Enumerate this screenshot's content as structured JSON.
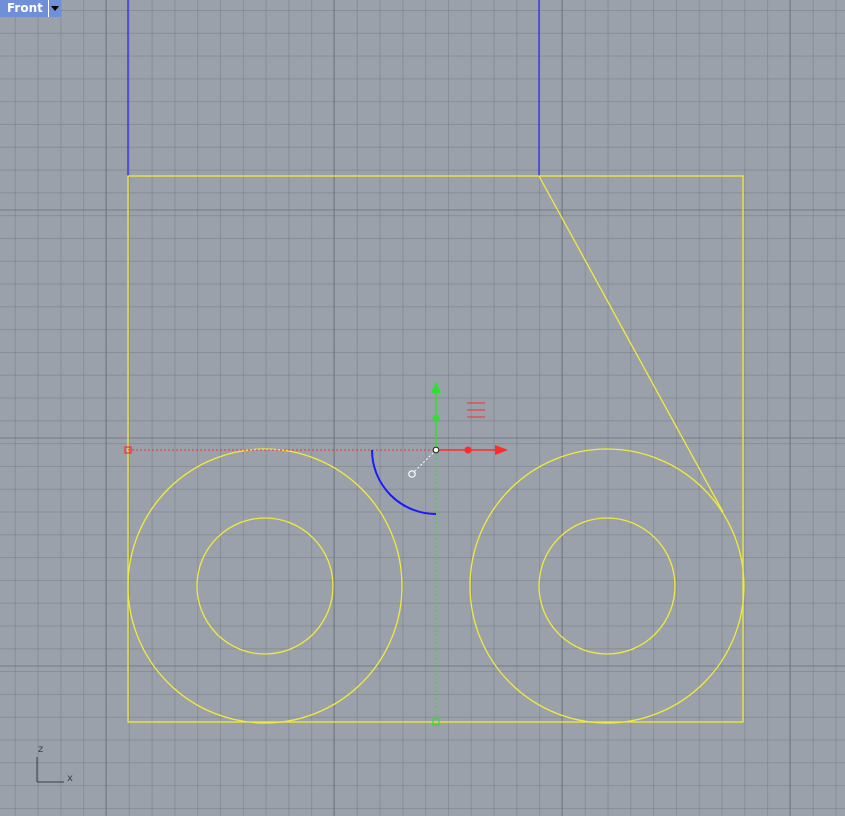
{
  "viewport": {
    "title": "Front",
    "view_menu_icon": "triangle-down-icon"
  },
  "axis_indicator": {
    "vertical_label": "z",
    "horizontal_label": "x"
  },
  "colors": {
    "background": "#9ba1aa",
    "grid": "#7e8690",
    "grid_major": "#6a727c",
    "curve_selected": "#f2ea3a",
    "curve_blue": "#3a3ae0",
    "gumball_x": "#ff2a2a",
    "gumball_y": "#33dd33",
    "gumball_rotate": "#1a1aff",
    "tab": "#6f8fd8"
  },
  "gumball": {
    "move_x_arrow_icon": "arrow-right-icon",
    "move_y_arrow_icon": "arrow-up-icon",
    "rotate_arc_icon": "rotate-arc-icon",
    "scale_x_handle_icon": "dot-handle-icon",
    "scale_y_handle_icon": "dot-handle-icon",
    "plane_icon": "plane-lines-icon"
  }
}
